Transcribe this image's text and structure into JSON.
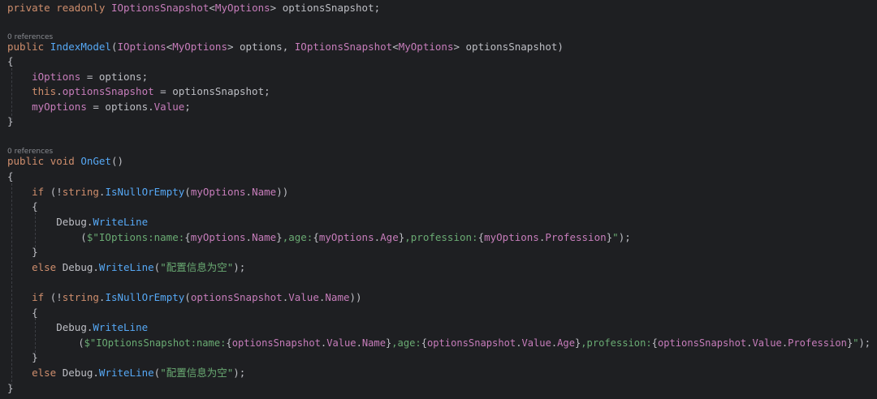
{
  "lines": [
    "private readonly IOptionsSnapshot<MyOptions> optionsSnapshot;",
    "0 references",
    "public IndexModel(IOptions<MyOptions> options, IOptionsSnapshot<MyOptions> optionsSnapshot)",
    "{",
    "    iOptions = options;",
    "    this.optionsSnapshot = optionsSnapshot;",
    "    myOptions = options.Value;",
    "}",
    "0 references",
    "public void OnGet()",
    "{",
    "    if (!string.IsNullOrEmpty(myOptions.Name))",
    "    {",
    "        Debug.WriteLine",
    "            ($\"IOptions:name:{myOptions.Name},age:{myOptions.Age},profession:{myOptions.Profession}\");",
    "    }",
    "    else Debug.WriteLine(\"配置信息为空\");",
    "    if (!string.IsNullOrEmpty(optionsSnapshot.Value.Name))",
    "    {",
    "        Debug.WriteLine",
    "            ($\"IOptionsSnapshot:name:{optionsSnapshot.Value.Name},age:{optionsSnapshot.Value.Age},profession:{optionsSnapshot.Value.Profession}\");",
    "    }",
    "    else Debug.WriteLine(\"配置信息为空\");",
    "}"
  ],
  "tokens": {
    "private": "private",
    "readonly": "readonly",
    "public": "public",
    "void": "void",
    "if": "if",
    "else": "else",
    "this": "this",
    "string": "string",
    "IOptionsSnapshot": "IOptionsSnapshot",
    "IOptions": "IOptions",
    "MyOptions": "MyOptions",
    "optionsSnapshot": "optionsSnapshot",
    "options": "options",
    "iOptions": "iOptions",
    "myOptions": "myOptions",
    "IndexModel": "IndexModel",
    "OnGet": "OnGet",
    "Value": "Value",
    "Name": "Name",
    "Age": "Age",
    "Profession": "Profession",
    "IsNullOrEmpty": "IsNullOrEmpty",
    "Debug": "Debug",
    "WriteLine": "WriteLine",
    "s_chinese": "\"配置信息为空\"",
    "s1_a": "$\"IOptions:name:",
    "s_age": ",age:",
    "s_prof": ",profession:",
    "s_end": "\"",
    "s2_a": "$\"IOptionsSnapshot:name:"
  },
  "colors": {
    "background": "#1e1f22",
    "keyword": "#cf8e6d",
    "type": "#c77dbb",
    "method": "#56a8f5",
    "string": "#6aab73",
    "text": "#bdbec4",
    "codelens": "#8a8c92"
  }
}
